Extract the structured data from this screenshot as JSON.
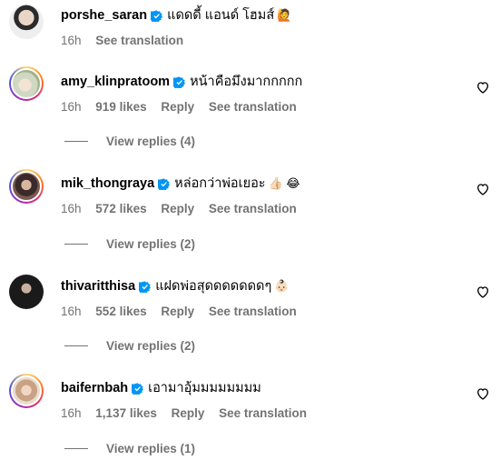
{
  "comments": [
    {
      "username": "porshe_saran",
      "text": "แดดดี้ แอนด์ โฮมส์",
      "emoji": "🙋",
      "time": "16h",
      "likes": "",
      "reply_label": "",
      "translate_label": "See translation",
      "view_replies": ""
    },
    {
      "username": "amy_klinpratoom",
      "text": "หน้าคือมึงมากกกกก",
      "emoji": "",
      "time": "16h",
      "likes": "919 likes",
      "reply_label": "Reply",
      "translate_label": "See translation",
      "view_replies": "View replies (4)"
    },
    {
      "username": "mik_thongraya",
      "text": "หล่อกว่าพ่อเยอะ",
      "emoji": "👍🏻 😂",
      "time": "16h",
      "likes": "572 likes",
      "reply_label": "Reply",
      "translate_label": "See translation",
      "view_replies": "View replies (2)"
    },
    {
      "username": "thivaritthisa",
      "text": "แฝดพ่อสุดดดดดดดๆ",
      "emoji": "👶🏻",
      "time": "16h",
      "likes": "552 likes",
      "reply_label": "Reply",
      "translate_label": "See translation",
      "view_replies": "View replies (2)"
    },
    {
      "username": "baifernbah",
      "text": "เอามาอุ้มมมมมมมม",
      "emoji": "",
      "time": "16h",
      "likes": "1,137 likes",
      "reply_label": "Reply",
      "translate_label": "See translation",
      "view_replies": "View replies (1)"
    }
  ],
  "icons": {
    "verified": "verified-badge-icon",
    "like": "heart-outline-icon"
  },
  "colors": {
    "verified": "#0095f6",
    "secondary_text": "#737373"
  }
}
